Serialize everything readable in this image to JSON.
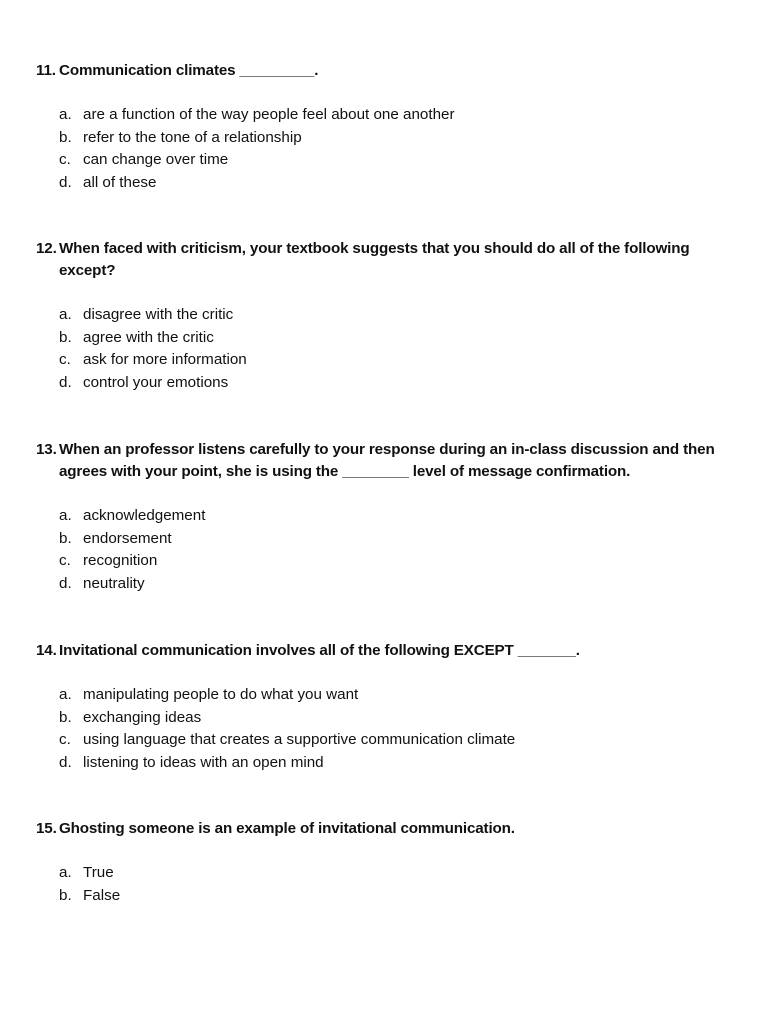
{
  "questions": [
    {
      "number": "11.",
      "text": "Communication climates _________.",
      "options": [
        {
          "letter": "a.",
          "text": "are a function of the way people feel about one another"
        },
        {
          "letter": "b.",
          "text": "refer to the tone of a relationship"
        },
        {
          "letter": "c.",
          "text": "can change over time"
        },
        {
          "letter": "d.",
          "text": "all of these"
        }
      ]
    },
    {
      "number": "12.",
      "text": "When faced with criticism, your textbook suggests that you should do all of the following except?",
      "options": [
        {
          "letter": "a.",
          "text": "disagree with the critic"
        },
        {
          "letter": "b.",
          "text": "agree with the critic"
        },
        {
          "letter": "c.",
          "text": "ask for more information"
        },
        {
          "letter": "d.",
          "text": "control your emotions"
        }
      ]
    },
    {
      "number": "13.",
      "text": "When an professor listens carefully to your response during an in-class discussion and then agrees with your point, she is using the ________  level of message confirmation.",
      "options": [
        {
          "letter": "a.",
          "text": "acknowledgement"
        },
        {
          "letter": "b.",
          "text": "endorsement"
        },
        {
          "letter": "c.",
          "text": "recognition"
        },
        {
          "letter": "d.",
          "text": "neutrality"
        }
      ]
    },
    {
      "number": "14.",
      "text": "Invitational communication involves all of the following EXCEPT _______.",
      "options": [
        {
          "letter": "a.",
          "text": "manipulating people to do what you want"
        },
        {
          "letter": "b.",
          "text": "exchanging ideas"
        },
        {
          "letter": "c.",
          "text": "using language that creates a supportive communication climate"
        },
        {
          "letter": "d.",
          "text": "listening to ideas with an open mind"
        }
      ]
    },
    {
      "number": "15.",
      "text": "Ghosting someone is an example of invitational communication.",
      "options": [
        {
          "letter": "a.",
          "text": "True"
        },
        {
          "letter": "b.",
          "text": "False"
        }
      ]
    }
  ]
}
